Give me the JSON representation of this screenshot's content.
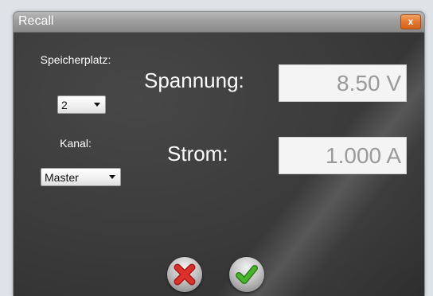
{
  "window": {
    "title": "Recall",
    "close_label": "x"
  },
  "form": {
    "slot_label": "Speicherplatz:",
    "slot_value": "2",
    "channel_label": "Kanal:",
    "channel_value": "Master",
    "voltage_label": "Spannung:",
    "voltage_value": "8.50 V",
    "current_label": "Strom:",
    "current_value": "1.000 A"
  },
  "icons": {
    "cancel": "cancel-x-icon",
    "confirm": "confirm-check-icon"
  },
  "colors": {
    "background": "#3e3e3e",
    "close_accent": "#e6772c",
    "cancel_red": "#e0302a",
    "confirm_green": "#46b52a"
  }
}
